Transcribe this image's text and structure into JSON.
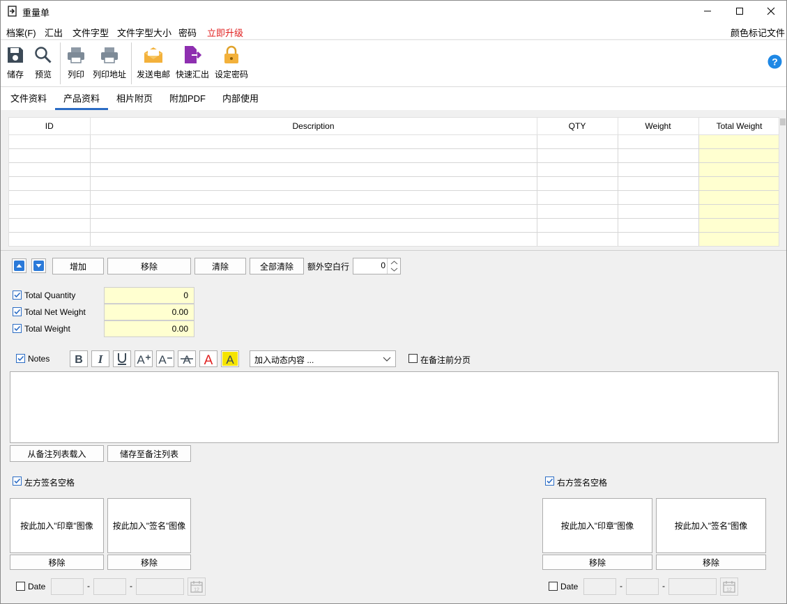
{
  "window": {
    "title": "重量单"
  },
  "menu": {
    "items": [
      "档案(F)",
      "汇出",
      "文件字型",
      "文件字型大小",
      "密码",
      "立即升级"
    ],
    "right": "颜色标记文件"
  },
  "toolbar": {
    "save": "储存",
    "preview": "预览",
    "print": "列印",
    "print_address": "列印地址",
    "send_email": "发送电邮",
    "quick_export": "快速汇出",
    "set_password": "设定密码"
  },
  "tabs": [
    "文件资料",
    "产品资料",
    "相片附页",
    "附加PDF",
    "内部使用"
  ],
  "grid": {
    "columns": [
      "ID",
      "Description",
      "QTY",
      "Weight",
      "Total Weight"
    ],
    "row_count": 8
  },
  "row_actions": {
    "add": "增加",
    "remove": "移除",
    "clear": "清除",
    "clear_all": "全部清除",
    "extra_blank_rows_label": "额外空白行",
    "extra_blank_rows_value": "0"
  },
  "totals": [
    {
      "label": "Total Quantity",
      "value": "0",
      "checked": true
    },
    {
      "label": "Total Net Weight",
      "value": "0.00",
      "checked": true
    },
    {
      "label": "Total Weight",
      "value": "0.00",
      "checked": true
    }
  ],
  "notes": {
    "label": "Notes",
    "checked": true,
    "dynamic_select": "加入动态内容 ...",
    "page_break_label": "在备注前分页",
    "page_break_checked": false,
    "text": "",
    "load_button": "从备注列表载入",
    "save_button": "储存至备注列表"
  },
  "signature_left": {
    "label": "左方签名空格",
    "checked": true,
    "stamp_button": "按此加入\"印章\"图像",
    "sign_button": "按此加入\"签名\"图像",
    "remove": "移除",
    "date_label": "Date",
    "date_checked": false,
    "date_sep": "-"
  },
  "signature_right": {
    "label": "右方签名空格",
    "checked": true,
    "stamp_button": "按此加入\"印章\"图像",
    "sign_button": "按此加入\"签名\"图像",
    "remove": "移除",
    "date_label": "Date",
    "date_checked": false,
    "date_sep": "-"
  },
  "colors": {
    "accent": "#2b6cc4",
    "upgrade": "#e02020",
    "yellow_field": "#ffffd0",
    "help": "#1e88e5"
  }
}
